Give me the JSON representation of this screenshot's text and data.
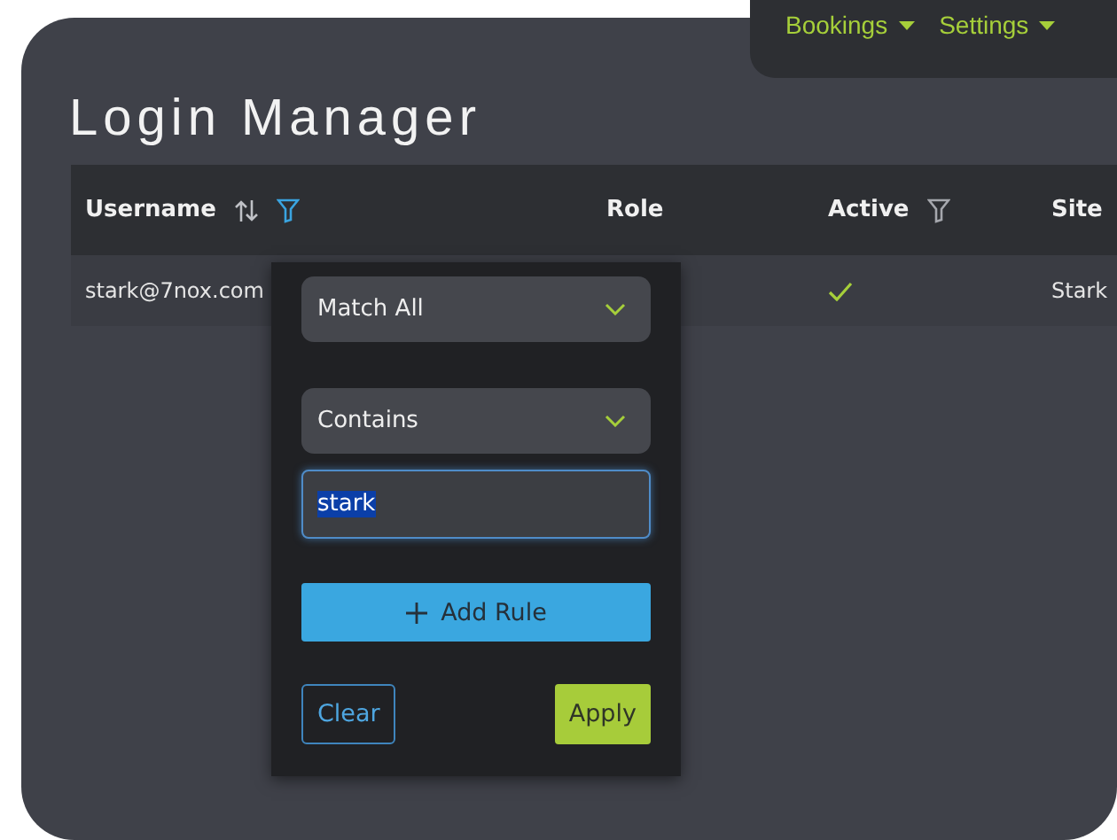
{
  "nav": {
    "items": [
      {
        "label": "Bookings"
      },
      {
        "label": "Settings"
      }
    ]
  },
  "title": "Login Manager",
  "table": {
    "columns": [
      {
        "label": "Username",
        "icons": [
          {
            "kind": "sort"
          },
          {
            "kind": "filter",
            "active": true
          }
        ]
      },
      {
        "label": "Role"
      },
      {
        "label": "Active",
        "icons": [
          {
            "kind": "filter",
            "active": false
          }
        ]
      },
      {
        "label": "Site"
      }
    ],
    "rows": [
      [
        {
          "kind": "text",
          "text": "stark@7nox.com"
        },
        {
          "kind": "empty"
        },
        {
          "kind": "check",
          "checked": true
        },
        {
          "kind": "text",
          "text": "Stark"
        }
      ]
    ]
  },
  "filter_popup": {
    "match_select": "Match All",
    "rule_select": "Contains",
    "value": "stark",
    "value_selected": true,
    "add_rule": "Add Rule",
    "clear": "Clear",
    "apply": "Apply"
  }
}
